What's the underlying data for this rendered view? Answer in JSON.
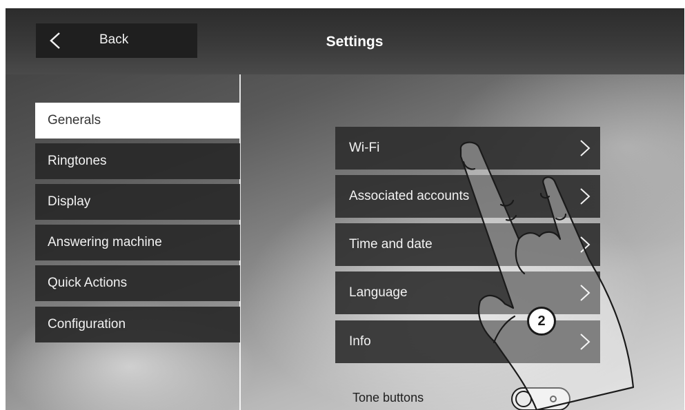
{
  "header": {
    "back_label": "Back",
    "title": "Settings"
  },
  "sidebar": {
    "items": [
      {
        "label": "Generals",
        "active": true
      },
      {
        "label": "Ringtones",
        "active": false
      },
      {
        "label": "Display",
        "active": false
      },
      {
        "label": "Answering machine",
        "active": false
      },
      {
        "label": "Quick Actions",
        "active": false
      },
      {
        "label": "Configuration",
        "active": false
      }
    ]
  },
  "main": {
    "items": [
      {
        "label": "Wi-Fi"
      },
      {
        "label": "Associated accounts"
      },
      {
        "label": "Time and date"
      },
      {
        "label": "Language"
      },
      {
        "label": "Info"
      }
    ],
    "tone_buttons": {
      "label": "Tone buttons",
      "state": "off"
    }
  },
  "annotation": {
    "step_number": "2"
  },
  "icons": {
    "back": "chevron-left-icon",
    "row": "chevron-right-icon",
    "hand": "pointing-hand-icon"
  },
  "colors": {
    "header_bg": "#3a3a3a",
    "menu_item_bg": "#282828",
    "active_item_bg": "#ffffff",
    "text_light": "#f2f2f2",
    "text_dark": "#333333"
  }
}
